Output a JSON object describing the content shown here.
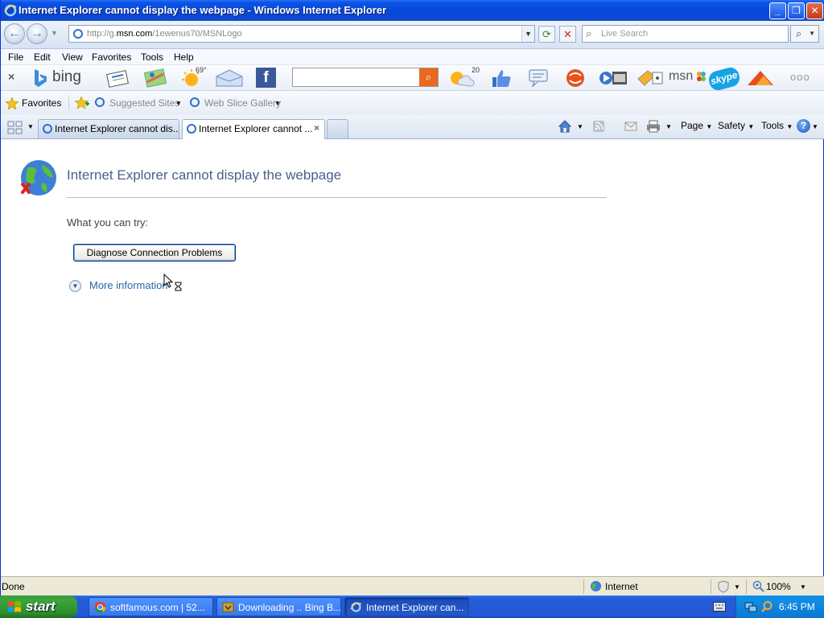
{
  "window": {
    "title": "Internet Explorer cannot display the webpage - Windows Internet Explorer"
  },
  "address": {
    "url_prefix": "http://g.",
    "url_domain": "msn.com",
    "url_path": "/1ewenus70/MSNLogo"
  },
  "search": {
    "placeholder": "Live Search"
  },
  "menu": {
    "file": "File",
    "edit": "Edit",
    "view": "View",
    "favorites": "Favorites",
    "tools": "Tools",
    "help": "Help"
  },
  "bing": {
    "logo": "bing",
    "weather_temp": "69°",
    "notif_count": "20",
    "msn": "msn"
  },
  "favbar": {
    "favorites": "Favorites",
    "suggested": "Suggested Sites",
    "webslice": "Web Slice Gallery"
  },
  "tabs": [
    {
      "label": "Internet Explorer cannot dis..."
    },
    {
      "label": "Internet Explorer cannot ..."
    }
  ],
  "commands": {
    "page": "Page",
    "safety": "Safety",
    "tools": "Tools"
  },
  "content": {
    "title": "Internet Explorer cannot display the webpage",
    "try": "What you can try:",
    "diagnose": "Diagnose Connection Problems",
    "more": "More information"
  },
  "status": {
    "text": "Done",
    "zone": "Internet",
    "zoom": "100%"
  },
  "taskbar": {
    "start": "start",
    "items": [
      {
        "label": "softfamous.com | 52..."
      },
      {
        "label": "Downloading .. Bing B..."
      },
      {
        "label": "Internet Explorer can..."
      }
    ],
    "clock": "6:45 PM"
  },
  "colors": {
    "titlebar": "#0a54e6",
    "taskbar": "#245edb",
    "start": "#3ca53c",
    "link": "#2769a3",
    "error_title": "#4a5f8a"
  }
}
